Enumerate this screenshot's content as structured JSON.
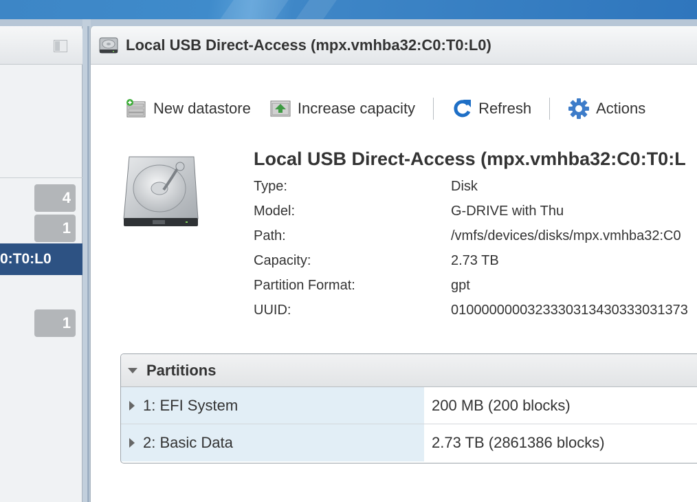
{
  "left_panel": {
    "badges": [
      "4",
      "1",
      "1"
    ],
    "selected_item": "0:T0:L0"
  },
  "main": {
    "header_title": "Local USB Direct-Access (mpx.vmhba32:C0:T0:L0)",
    "toolbar": {
      "new_datastore": "New datastore",
      "increase_capacity": "Increase capacity",
      "refresh": "Refresh",
      "actions": "Actions"
    },
    "info": {
      "title": "Local USB Direct-Access (mpx.vmhba32:C0:T0:L",
      "rows": [
        {
          "label": "Type:",
          "value": "Disk"
        },
        {
          "label": "Model:",
          "value": "G-DRIVE with Thu"
        },
        {
          "label": "Path:",
          "value": "/vmfs/devices/disks/mpx.vmhba32:C0"
        },
        {
          "label": "Capacity:",
          "value": "2.73 TB"
        },
        {
          "label": "Partition Format:",
          "value": "gpt"
        },
        {
          "label": "UUID:",
          "value": "0100000000323330313430333031373"
        }
      ]
    },
    "partitions": {
      "title": "Partitions",
      "rows": [
        {
          "name": "1: EFI System",
          "size": "200 MB (200 blocks)"
        },
        {
          "name": "2: Basic Data",
          "size": "2.73 TB (2861386 blocks)"
        }
      ]
    }
  },
  "colors": {
    "banner": "#3d86c6",
    "selected": "#2d5283",
    "partition_name_bg": "#e2eef6",
    "refresh_icon": "#1e6fc6",
    "actions_gear": "#3d7cc9"
  }
}
